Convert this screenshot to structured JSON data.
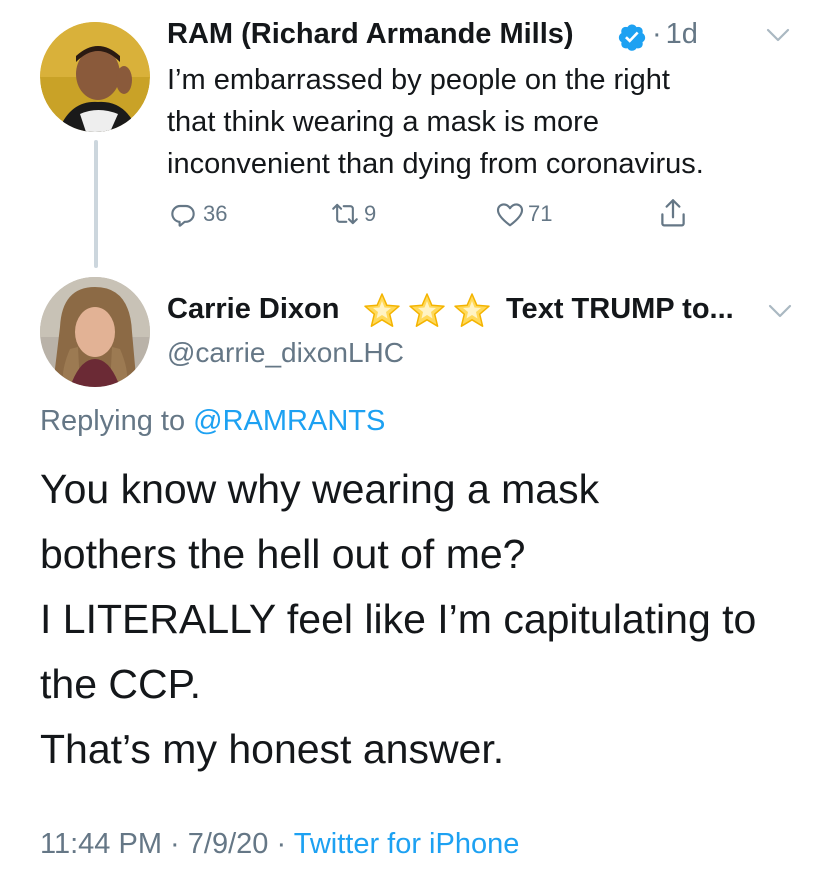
{
  "tweet1": {
    "author_name": "RAM (Richard Armande Mills)",
    "verified": true,
    "separator": "·",
    "time": "1d",
    "text_lines": [
      "I’m embarrassed by people on the right",
      "that think wearing a mask is more",
      "inconvenient than dying from coronavirus."
    ],
    "replies": "36",
    "retweets": "9",
    "likes": "71"
  },
  "tweet2": {
    "author_name": "Carrie Dixon",
    "stars_count": 3,
    "name_suffix": "Text TRUMP to...",
    "handle": "@carrie_dixonLHC",
    "replying_label": "Replying to",
    "replying_handle": "@RAMRANTS",
    "text_lines": [
      "You know why wearing a mask",
      "bothers the hell out of me?",
      "I LITERALLY feel like I’m capitulating to",
      "the CCP.",
      "That’s my honest answer."
    ],
    "time": "11:44 PM",
    "date": "7/9/20",
    "separator": "·",
    "source": "Twitter for iPhone"
  },
  "colors": {
    "text_primary": "#14171a",
    "text_secondary": "#657786",
    "link": "#1da1f2",
    "verified": "#1da1f2",
    "star": "#ffcc4d"
  },
  "icons": {
    "reply": "reply-icon",
    "retweet": "retweet-icon",
    "like": "like-icon",
    "share": "share-icon",
    "caret": "chevron-down-icon",
    "verified": "verified-badge-icon",
    "star": "star-emoji-icon"
  }
}
